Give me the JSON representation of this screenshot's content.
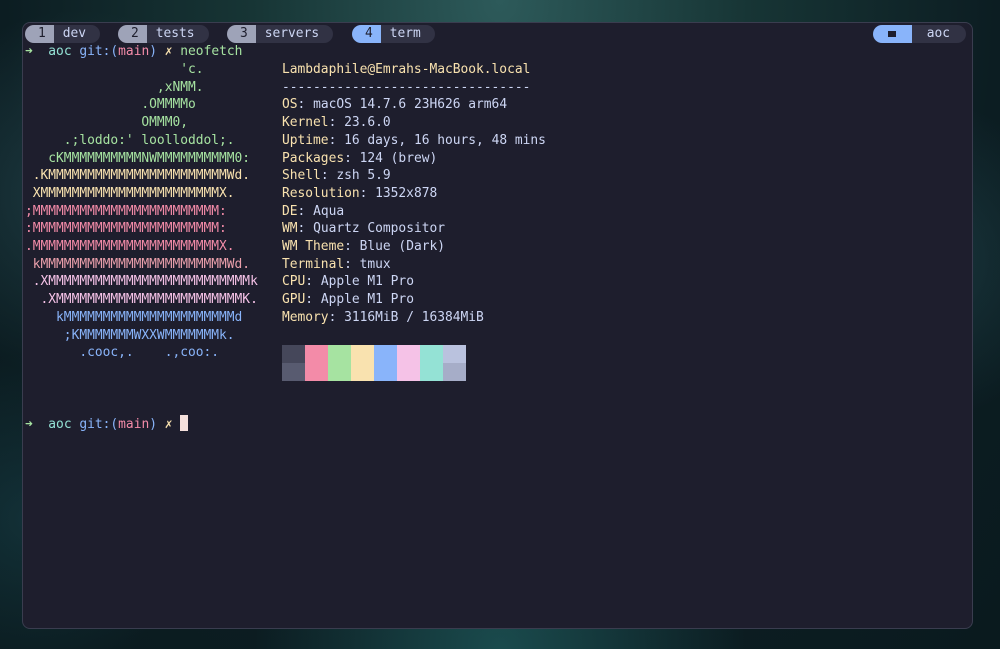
{
  "tabs": [
    {
      "index": "1",
      "label": "dev",
      "active": false
    },
    {
      "index": "2",
      "label": "tests",
      "active": false
    },
    {
      "index": "3",
      "label": "servers",
      "active": false
    },
    {
      "index": "4",
      "label": "term",
      "active": true
    }
  ],
  "session": {
    "icon": "terminal-icon",
    "name": "aoc"
  },
  "prompt": {
    "arrow": "➜",
    "dir": "aoc",
    "git_prefix": "git:(",
    "branch": "main",
    "git_suffix": ")",
    "dirty": "✗",
    "command": "neofetch"
  },
  "logo": [
    {
      "text": "                    'c.",
      "color": "#a6e3a1"
    },
    {
      "text": "                 ,xNMM.",
      "color": "#a6e3a1"
    },
    {
      "text": "               .OMMMMo",
      "color": "#a6e3a1"
    },
    {
      "text": "               OMMM0,",
      "color": "#a6e3a1"
    },
    {
      "text": "     .;loddo:' loolloddol;.",
      "color": "#a6e3a1"
    },
    {
      "text": "   cKMMMMMMMMMMNWMMMMMMMMMM0:",
      "color": "#a6e3a1"
    },
    {
      "text": " .KMMMMMMMMMMMMMMMMMMMMMMMWd.",
      "color": "#f9e2af"
    },
    {
      "text": " XMMMMMMMMMMMMMMMMMMMMMMMX.",
      "color": "#f9e2af"
    },
    {
      "text": ";MMMMMMMMMMMMMMMMMMMMMMMM:",
      "color": "#f38ba8"
    },
    {
      "text": ":MMMMMMMMMMMMMMMMMMMMMMMM:",
      "color": "#f38ba8"
    },
    {
      "text": ".MMMMMMMMMMMMMMMMMMMMMMMMX.",
      "color": "#f38ba8"
    },
    {
      "text": " kMMMMMMMMMMMMMMMMMMMMMMMMWd.",
      "color": "#eba0ac"
    },
    {
      "text": " .XMMMMMMMMMMMMMMMMMMMMMMMMMMk",
      "color": "#f5c2e7"
    },
    {
      "text": "  .XMMMMMMMMMMMMMMMMMMMMMMMMK.",
      "color": "#f5c2e7"
    },
    {
      "text": "    kMMMMMMMMMMMMMMMMMMMMMMd",
      "color": "#89b4fa"
    },
    {
      "text": "     ;KMMMMMMMWXXWMMMMMMMk.",
      "color": "#89b4fa"
    },
    {
      "text": "       .cooc,.    .,coo:.",
      "color": "#89b4fa"
    }
  ],
  "info": {
    "title": "Lambdaphile@Emrahs-MacBook.local",
    "separator": "--------------------------------",
    "rows": [
      {
        "key": "OS",
        "value": "macOS 14.7.6 23H626 arm64"
      },
      {
        "key": "Kernel",
        "value": "23.6.0"
      },
      {
        "key": "Uptime",
        "value": "16 days, 16 hours, 48 mins"
      },
      {
        "key": "Packages",
        "value": "124 (brew)"
      },
      {
        "key": "Shell",
        "value": "zsh 5.9"
      },
      {
        "key": "Resolution",
        "value": "1352x878"
      },
      {
        "key": "DE",
        "value": "Aqua"
      },
      {
        "key": "WM",
        "value": "Quartz Compositor"
      },
      {
        "key": "WM Theme",
        "value": "Blue (Dark)"
      },
      {
        "key": "Terminal",
        "value": "tmux"
      },
      {
        "key": "CPU",
        "value": "Apple M1 Pro"
      },
      {
        "key": "GPU",
        "value": "Apple M1 Pro"
      },
      {
        "key": "Memory",
        "value": "3116MiB / 16384MiB"
      }
    ],
    "colors_top": [
      "#45475a",
      "#f38ba8",
      "#a6e3a1",
      "#f9e2af",
      "#89b4fa",
      "#f5c2e7",
      "#94e2d5",
      "#bac2de"
    ],
    "colors_bottom": [
      "#585b70",
      "#f38ba8",
      "#a6e3a1",
      "#f9e2af",
      "#89b4fa",
      "#f5c2e7",
      "#94e2d5",
      "#a6adc8"
    ]
  }
}
